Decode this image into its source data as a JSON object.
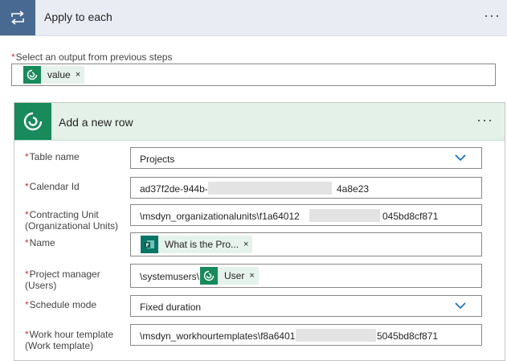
{
  "loop": {
    "title": "Apply to each",
    "more": "···",
    "output_label": "Select an output from previous steps",
    "output_token": {
      "label": "value",
      "remove": "×"
    }
  },
  "action": {
    "title": "Add a new row",
    "more": "···",
    "fields": {
      "table_name": {
        "label": "Table name",
        "value": "Projects"
      },
      "calendar_id": {
        "label": "Calendar Id",
        "value_start": "ad37f2de-944b-",
        "value_end": "4a8e23"
      },
      "contracting_unit": {
        "label_line1": "Contracting Unit",
        "label_line2": "(Organizational Units)",
        "value_start": "\\msdyn_organizationalunits\\f1a64012",
        "value_end": "045bd8cf871"
      },
      "name": {
        "label": "Name",
        "token_label": "What is the Pro...",
        "remove": "×"
      },
      "project_manager": {
        "label_line1": "Project manager",
        "label_line2": "(Users)",
        "prefix": "\\systemusers\\",
        "token_label": "User",
        "remove": "×"
      },
      "schedule_mode": {
        "label": "Schedule mode",
        "value": "Fixed duration"
      },
      "work_hour_template": {
        "label_line1": "Work hour template",
        "label_line2": "(Work template)",
        "value_start": "\\msdyn_workhourtemplates\\f8a6401",
        "value_end": "5045bd8cf871"
      }
    }
  },
  "icons": {
    "loop": "loop-arrows-icon",
    "dataverse": "dataverse-icon",
    "forms": "forms-icon",
    "chevron": "chevron-down-icon"
  },
  "colors": {
    "loop_accent": "#486991",
    "dataverse_green": "#188a5c",
    "forms_teal": "#077568",
    "required": "#d13438",
    "chevron_blue": "#0f6cbd"
  }
}
